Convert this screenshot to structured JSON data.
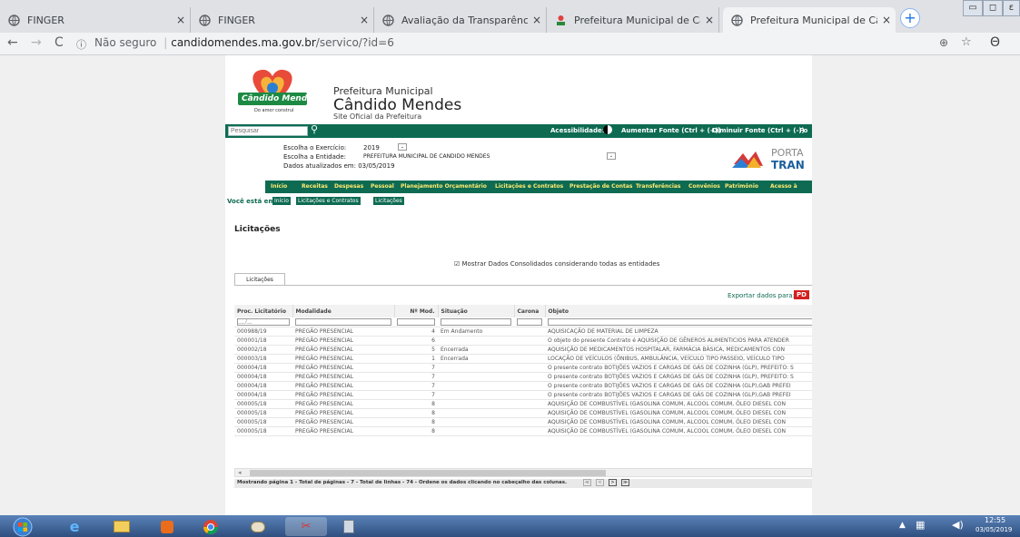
{
  "browser": {
    "tabs": [
      {
        "title": "FINGER",
        "close": "×"
      },
      {
        "title": "FINGER",
        "close": "×"
      },
      {
        "title": "Avaliação da Transparência dos",
        "close": "×"
      },
      {
        "title": "Prefeitura Municipal de Cândido",
        "close": "×"
      },
      {
        "title": "Prefeitura Municipal de Cândido",
        "close": "×"
      }
    ],
    "new_tab": "+",
    "security": "Não seguro",
    "url_domain": "candidomendes.ma.gov.br",
    "url_path": "/servico/?id=6",
    "win_min": "▭",
    "win_max": "◻",
    "win_close": "ε"
  },
  "site": {
    "logo_text": "Cândido Mendes",
    "logo_tagline": "Do amor construí",
    "header_line1": "Prefeitura Municipal",
    "header_line2": "Cândido Mendes",
    "header_line3": "Site Oficial da Prefeitura",
    "search_placeholder": "Pesquisar",
    "accessibility": "Acessibilidade:",
    "font_up": "Aumentar Fonte (Ctrl + (+))",
    "font_down": "Diminuir Fonte (Ctrl + (-))",
    "font_extra": "Fo",
    "exercicio_label": "Escolha o Exercício:",
    "exercicio_value": "2019",
    "entidade_label": "Escolha a Entidade:",
    "entidade_value": "PREFEITURA MUNICIPAL DE CANDIDO MENDES",
    "updated": "Dados atualizados em: 03/05/2019",
    "portal_1": "PORTA",
    "portal_2": "TRAN",
    "menu": [
      "Início",
      "Receitas",
      "Despesas",
      "Pessoal",
      "Planejamento Orçamentário",
      "Licitações e Contratos",
      "Prestação de Contas",
      "Transferências",
      "Convênios",
      "Patrimônio",
      "Acesso à"
    ],
    "breadcrumb_label": "Você está em:",
    "breadcrumb": [
      "Início",
      "Licitações e Contratos",
      "Licitações"
    ],
    "page_title": "Licitações",
    "checkbox_label": "Mostrar Dados Consolidados considerando todas as entidades",
    "inner_tab": "Licitações",
    "export_label": "Exportar dados para:",
    "export_pdf": "PD",
    "filter_placeholder": "___/__",
    "footer_text": "Mostrando página 1 - Total de páginas - 7 - Total de linhas - 74 - Ordene os dados clicando no cabeçalho das colunas.",
    "pager": [
      "≪",
      "<",
      ">",
      "≫"
    ]
  },
  "table": {
    "headers": [
      "Proc. Licitatório",
      "Modalidade",
      "Nº Mod.",
      "Situação",
      "Carona",
      "Objeto"
    ],
    "rows": [
      [
        "000988/19",
        "PREGÃO PRESENCIAL",
        "4",
        "Em Andamento",
        "",
        "AQUISICAÇÃO DE MATERIAL DE LIMPEZA"
      ],
      [
        "000001/18",
        "PREGÃO PRESENCIAL",
        "6",
        "",
        "",
        "O objeto do presente Contrato é AQUISIÇÃO DE GÊNEROS ALIMENTICIOS PARA ATENDER"
      ],
      [
        "000002/18",
        "PREGÃO PRESENCIAL",
        "5",
        "Encerrada",
        "",
        "AQUISIÇÃO DE MEDICAMENTOS HOSPITALAR, FARMÁCIA BÁSICA, MEDICAMENTOS CON"
      ],
      [
        "000003/18",
        "PREGÃO PRESENCIAL",
        "1",
        "Encerrada",
        "",
        "LOCAÇÃO DE VEÍCULOS (ÔNIBUS, AMBULÂNCIA, VEÍCULO TIPO PASSEIO, VEÍCULO TIPO"
      ],
      [
        "000004/18",
        "PREGÃO PRESENCIAL",
        "7",
        "",
        "",
        "O presente contrato BOTIJÕES VAZIOS E CARGAS DE GÁS DE COZINHA (GLP), PREFEITO: S"
      ],
      [
        "000004/18",
        "PREGÃO PRESENCIAL",
        "7",
        "",
        "",
        "O presente contrato BOTIJÕES VAZIOS E CARGAS DE GÁS DE COZINHA (GLP), PREFEITO: S"
      ],
      [
        "000004/18",
        "PREGÃO PRESENCIAL",
        "7",
        "",
        "",
        "O presente contrato BOTIJÕES VAZIOS E CARGAS DE GÁS DE COZINHA (GLP),GAB PREFEI"
      ],
      [
        "000004/18",
        "PREGÃO PRESENCIAL",
        "7",
        "",
        "",
        "O presente contrato BOTIJÕES VAZIOS E CARGAS DE GÁS DE COZINHA (GLP),GAB PREFEI"
      ],
      [
        "000005/18",
        "PREGÃO PRESENCIAL",
        "8",
        "",
        "",
        "AQUISIÇÃO DE COMBUSTÍVEL (GASOLINA COMUM, ALCOOL COMUM, ÓLEO DIESEL CON"
      ],
      [
        "000005/18",
        "PREGÃO PRESENCIAL",
        "8",
        "",
        "",
        "AQUISIÇÃO DE COMBUSTÍVEL (GASOLINA COMUM, ALCOOL COMUM, ÓLEO DIESEL CON"
      ],
      [
        "000005/18",
        "PREGÃO PRESENCIAL",
        "8",
        "",
        "",
        "AQUISIÇÃO DE COMBUSTÍVEL (GASOLINA COMUM, ALCOOL COMUM, ÓLEO DIESEL CON"
      ],
      [
        "000005/18",
        "PREGÃO PRESENCIAL",
        "8",
        "",
        "",
        "AQUISIÇÃO DE COMBUSTÍVEL (GASOLINA COMUM, ALCOOL COMUM, ÓLEO DIESEL CON"
      ]
    ]
  },
  "taskbar": {
    "time": "12:55",
    "date": "03/05/2019"
  },
  "colors": {
    "site_green": "#0e6b52",
    "menu_text": "#ffeb70",
    "breadcrumb_bg": "#0e6b52",
    "pdf_red": "#d42020"
  }
}
